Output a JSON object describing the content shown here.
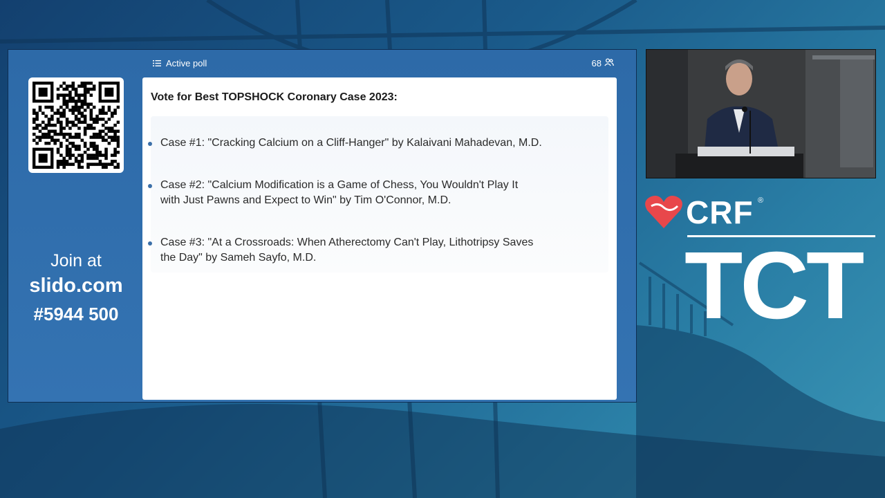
{
  "slido": {
    "join_line1": "Join at",
    "join_site": "slido.com",
    "join_code": "#5944 500"
  },
  "poll": {
    "status_label": "Active poll",
    "participant_count": "68",
    "question": "Vote for Best TOPSHOCK Coronary Case 2023:",
    "options": [
      {
        "line1": "Case #1: \"Cracking Calcium on a Cliff-Hanger\" by Kalaivani Mahadevan, M.D.",
        "line2": ""
      },
      {
        "line1": "Case #2: \"Calcium Modification is a Game of Chess, You Wouldn't Play It",
        "line2": "with Just Pawns and Expect to Win\" by Tim O'Connor, M.D."
      },
      {
        "line1": "Case #3: \"At a Crossroads: When Atherectomy Can't Play, Lithotripsy Saves",
        "line2": "the Day\" by Sameh Sayfo, M.D."
      }
    ]
  },
  "branding": {
    "crf": "CRF",
    "reg_mark": "®",
    "tct": "TCT",
    "accent_color": "#e8474b"
  },
  "icons": [
    "list-icon",
    "people-icon",
    "qr-code",
    "crf-heart-logo"
  ]
}
